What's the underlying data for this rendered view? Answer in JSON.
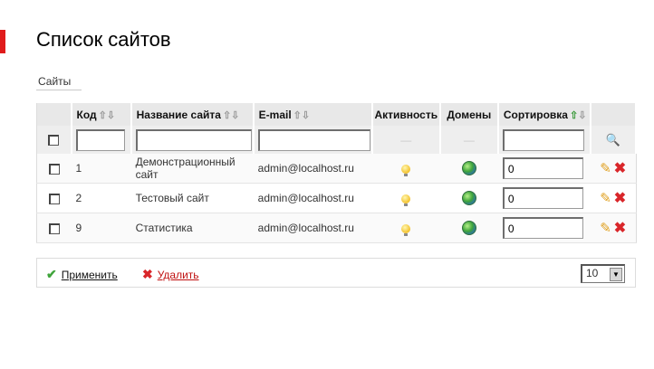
{
  "page": {
    "title": "Список сайтов",
    "tab": "Сайты"
  },
  "table": {
    "columns": [
      {
        "label": "Код",
        "sortable": true
      },
      {
        "label": "Название сайта",
        "sortable": true
      },
      {
        "label": "E-mail",
        "sortable": true
      },
      {
        "label": "Активность",
        "sortable": false
      },
      {
        "label": "Домены",
        "sortable": false
      },
      {
        "label": "Сортировка",
        "sortable": true,
        "active_sort": "up"
      }
    ],
    "filter": {
      "dash_activity": "—",
      "dash_domains": "—"
    },
    "rows": [
      {
        "id": "1",
        "name": "Демонстрационный сайт",
        "email": "admin@localhost.ru",
        "sort": "0"
      },
      {
        "id": "2",
        "name": "Тестовый сайт",
        "email": "admin@localhost.ru",
        "sort": "0"
      },
      {
        "id": "9",
        "name": "Статистика",
        "email": "admin@localhost.ru",
        "sort": "0"
      }
    ]
  },
  "footer": {
    "apply_label": "Применить",
    "delete_label": "Удалить",
    "page_size": "10"
  },
  "colors": {
    "accent_red": "#e01b1b",
    "active_sort_green": "#3a9a3a"
  },
  "icons": [
    "checkbox-icon",
    "lightbulb-icon",
    "globe-icon",
    "pencil-icon",
    "delete-x-icon",
    "magnifier-icon",
    "checkmark-icon",
    "dropdown-arrow-icon"
  ]
}
